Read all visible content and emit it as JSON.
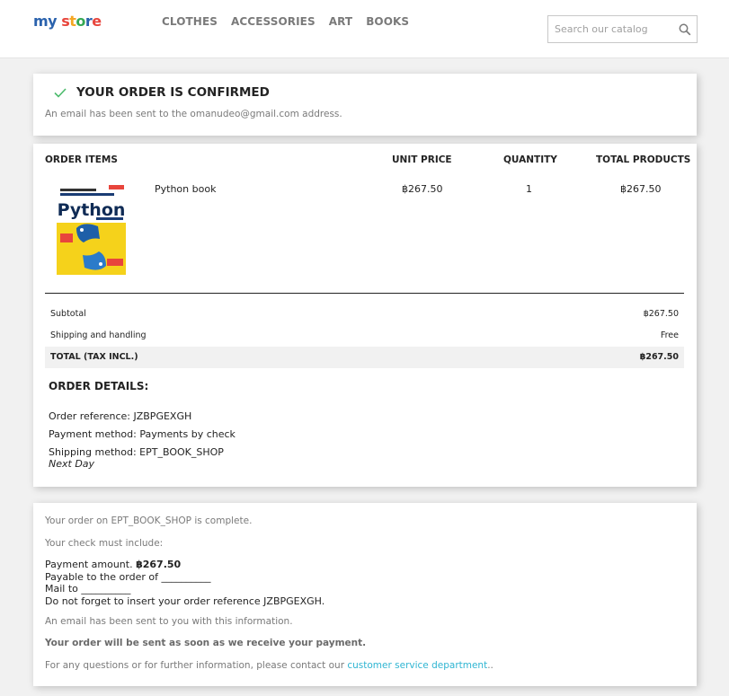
{
  "header": {
    "logo": {
      "letters": [
        "m",
        "y",
        " ",
        "s",
        "t",
        "o",
        "r",
        "e"
      ],
      "colors": [
        "#2a62ad",
        "#2a62ad",
        "#ffffff",
        "#e8453c",
        "#f5a623",
        "#34a853",
        "#2a62ad",
        "#e8453c"
      ]
    },
    "nav": [
      "CLOTHES",
      "ACCESSORIES",
      "ART",
      "BOOKS"
    ],
    "search_placeholder": "Search our catalog"
  },
  "confirmation": {
    "title": "YOUR ORDER IS CONFIRMED",
    "subtitle": "An email has been sent to the omanudeo@gmail.com address.",
    "accent": "#4cbb6c"
  },
  "order": {
    "headers": {
      "items": "ORDER ITEMS",
      "unit_price": "UNIT PRICE",
      "quantity": "QUANTITY",
      "total": "TOTAL PRODUCTS"
    },
    "product": {
      "name": "Python book",
      "unit_price": "฿267.50",
      "quantity": "1",
      "total": "฿267.50",
      "cover_title": "Python"
    },
    "subtotal_label": "Subtotal",
    "subtotal_value": "฿267.50",
    "shipping_label": "Shipping and handling",
    "shipping_value": "Free",
    "total_label": "TOTAL (TAX INCL.)",
    "total_value": "฿267.50",
    "details_title": "ORDER DETAILS:",
    "reference": "Order reference: JZBPGEXGH",
    "payment": "Payment method: Payments by check",
    "shipping_method": "Shipping method: EPT_BOOK_SHOP",
    "shipping_speed": "Next Day"
  },
  "payment_info": {
    "complete": "Your order on EPT_BOOK_SHOP is complete.",
    "check_include": "Your check must include:",
    "amount_label": "Payment amount.",
    "amount_value": "฿267.50",
    "payable": "Payable to the order of __________",
    "mail": "Mail to __________",
    "reminder": "Do not forget to insert your order reference JZBPGEXGH.",
    "email_sent": "An email has been sent to you with this information.",
    "sent_notice": "Your order will be sent as soon as we receive your payment.",
    "questions": "For any questions or for further information, please contact our",
    "link": "customer service department",
    "link_suffix": ".."
  }
}
